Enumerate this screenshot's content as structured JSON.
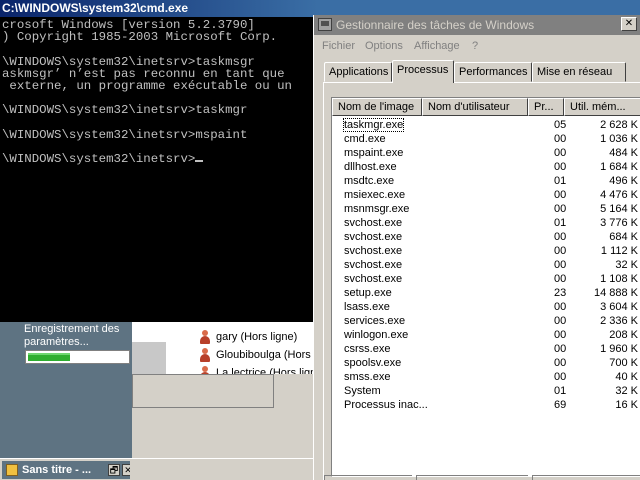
{
  "cmd": {
    "title": "C:\\WINDOWS\\system32\\cmd.exe",
    "lines": [
      "crosoft Windows [version 5.2.3790]",
      ") Copyright 1985-2003 Microsoft Corp.",
      "",
      "\\WINDOWS\\system32\\inetsrv>taskmsgr",
      "askmsgr’ n’est pas reconnu en tant que",
      " externe, un programme exécutable ou un",
      "",
      "\\WINDOWS\\system32\\inetsrv>taskmgr",
      "",
      "\\WINDOWS\\system32\\inetsrv>mspaint",
      "",
      "\\WINDOWS\\system32\\inetsrv>"
    ]
  },
  "background_app": {
    "status_text": "Enregistrement des paramètres...",
    "progress_fraction": 0.42,
    "contacts": [
      {
        "name": "gary (Hors ligne)"
      },
      {
        "name": "Gloubiboulga (Hors l"
      },
      {
        "name": "La lectrice (Hors ligne)"
      }
    ]
  },
  "taskbar": {
    "paint_button_label": "Sans titre - ...",
    "restore_glyph": "🗗",
    "close_glyph": "✕"
  },
  "taskmgr": {
    "title": "Gestionnaire des tâches de Windows",
    "close_glyph": "✕",
    "menu": [
      "Fichier",
      "Options",
      "Affichage",
      "?"
    ],
    "tabs": [
      "Applications",
      "Processus",
      "Performances",
      "Mise en réseau"
    ],
    "active_tab": "Processus",
    "columns": [
      "Nom de l'image",
      "Nom d'utilisateur",
      "Pr...",
      "Util. mém..."
    ],
    "processes": [
      {
        "name": "taskmgr.exe",
        "cpu": "05",
        "mem": "2 628 K"
      },
      {
        "name": "cmd.exe",
        "cpu": "00",
        "mem": "1 036 K"
      },
      {
        "name": "mspaint.exe",
        "cpu": "00",
        "mem": "484 K"
      },
      {
        "name": "dllhost.exe",
        "cpu": "00",
        "mem": "1 684 K"
      },
      {
        "name": "msdtc.exe",
        "cpu": "01",
        "mem": "496 K"
      },
      {
        "name": "msiexec.exe",
        "cpu": "00",
        "mem": "4 476 K"
      },
      {
        "name": "msnmsgr.exe",
        "cpu": "00",
        "mem": "5 164 K"
      },
      {
        "name": "svchost.exe",
        "cpu": "01",
        "mem": "3 776 K"
      },
      {
        "name": "svchost.exe",
        "cpu": "00",
        "mem": "684 K"
      },
      {
        "name": "svchost.exe",
        "cpu": "00",
        "mem": "1 112 K"
      },
      {
        "name": "svchost.exe",
        "cpu": "00",
        "mem": "32 K"
      },
      {
        "name": "svchost.exe",
        "cpu": "00",
        "mem": "1 108 K"
      },
      {
        "name": "setup.exe",
        "cpu": "23",
        "mem": "14 888 K"
      },
      {
        "name": "lsass.exe",
        "cpu": "00",
        "mem": "3 604 K"
      },
      {
        "name": "services.exe",
        "cpu": "00",
        "mem": "2 336 K"
      },
      {
        "name": "winlogon.exe",
        "cpu": "00",
        "mem": "208 K"
      },
      {
        "name": "csrss.exe",
        "cpu": "00",
        "mem": "1 960 K"
      },
      {
        "name": "spoolsv.exe",
        "cpu": "00",
        "mem": "700 K"
      },
      {
        "name": "smss.exe",
        "cpu": "00",
        "mem": "40 K"
      },
      {
        "name": "System",
        "cpu": "01",
        "mem": "32 K"
      },
      {
        "name": "Processus inac...",
        "cpu": "69",
        "mem": "16 K"
      }
    ]
  },
  "colors": {
    "cmd_background": "#000000",
    "cmd_text": "#c0c0c0",
    "desktop": "#3a6ea5",
    "progress_fill": "#2fae2f",
    "inactive_title": "#808080"
  }
}
